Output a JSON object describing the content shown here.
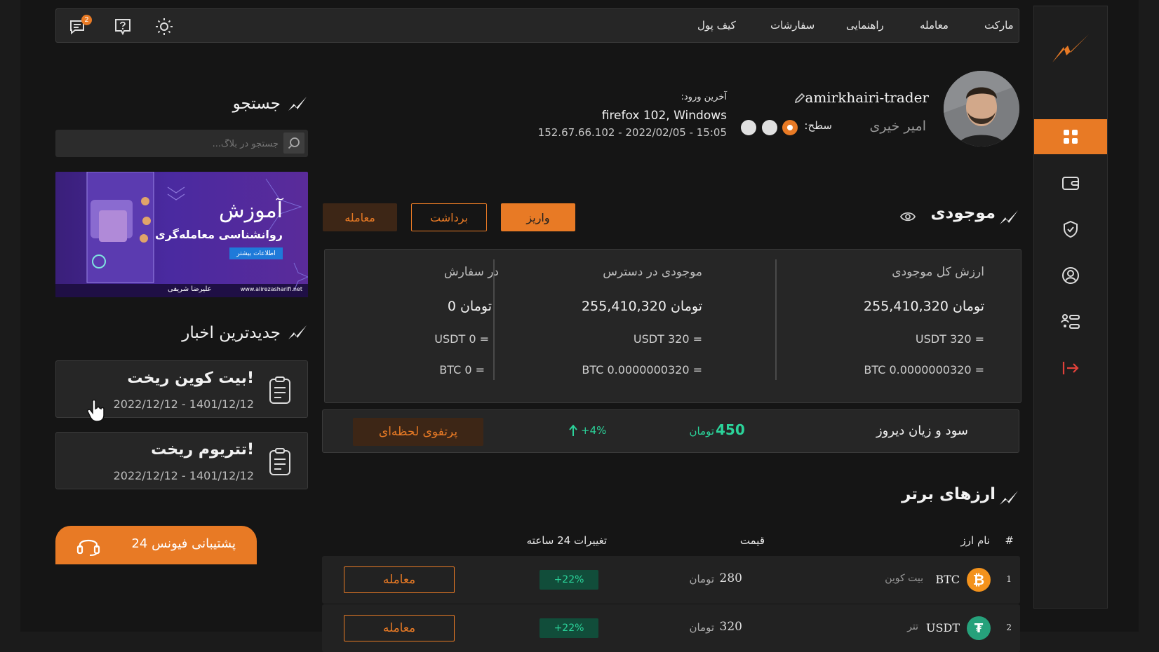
{
  "nav": {
    "links": [
      "مارکت",
      "معامله",
      "راهنمایی",
      "سفارشات",
      "کیف پول"
    ],
    "notification_count": "2"
  },
  "profile": {
    "username": "amirkhairi-trader",
    "full_name": "امیر خیری",
    "level_label": "سطح:",
    "last_login_label": "آخرین ورود:",
    "browser": "firefox 102, Windows",
    "ip_time": "152.67.66.102 - 2022/02/05 - 15:05"
  },
  "balance": {
    "title": "موجودی",
    "deposit": "واریز",
    "withdraw": "برداشت",
    "trade": "معامله",
    "columns": [
      {
        "header": "ارزش کل موجودی",
        "toman": "255,410,320 تومان",
        "usdt": "USDT 320 =",
        "btc": "BTC 0.0000000320 ="
      },
      {
        "header": "موجودی در دسترس",
        "toman": "255,410,320 تومان",
        "usdt": "USDT 320 =",
        "btc": "BTC 0.0000000320 ="
      },
      {
        "header": "در سفارش",
        "toman": "0 تومان",
        "usdt": "USDT 0 =",
        "btc": "BTC 0 ="
      }
    ]
  },
  "pnl": {
    "label": "سود و زیان دیروز",
    "value": "450",
    "unit": "تومان",
    "percent": "+4%",
    "portfolio_button": "پرتفوی لحظه‌ای"
  },
  "top_coins": {
    "title": "ارزهای برتر",
    "headers": {
      "rank": "#",
      "name": "نام ارز",
      "price": "قیمت",
      "change": "تغییرات 24 ساعته"
    },
    "rows": [
      {
        "rank": "1",
        "symbol": "BTC",
        "name": "بیت کوین",
        "price": "280",
        "unit": "تومان",
        "change": "+22%",
        "action": "معامله"
      },
      {
        "rank": "2",
        "symbol": "USDT",
        "name": "تتر",
        "price": "320",
        "unit": "تومان",
        "change": "+22%",
        "action": "معامله"
      }
    ]
  },
  "search": {
    "title": "جستجو",
    "placeholder": "جستجو در بلاگ..."
  },
  "banner": {
    "heading": "آموزش",
    "subheading": "روانشناسی معامله‌گری",
    "cta": "اطلاعات بیشتر",
    "author": "علیرضا شریفی",
    "url": "www.alirezasharifi.net"
  },
  "news": {
    "title": "جدیدترین اخبار",
    "items": [
      {
        "title": "بیت کوین ریخت!",
        "date": "2022/12/12 - 1401/12/12"
      },
      {
        "title": "تتریوم ریخت!",
        "date": "2022/12/12 - 1401/12/12"
      }
    ]
  },
  "support": {
    "label": "پشتیبانی فیونس 24"
  },
  "colors": {
    "accent": "#e87a25",
    "positive": "#2bd39a",
    "logout": "#e0413a"
  }
}
